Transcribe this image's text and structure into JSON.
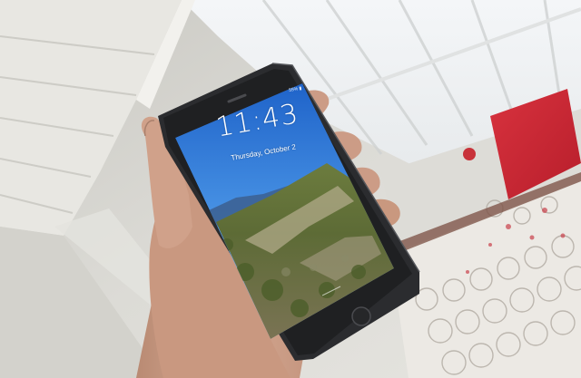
{
  "lock_screen": {
    "time": "11:43",
    "date": "Thursday, October 2",
    "status_battery": "55% ▮"
  }
}
